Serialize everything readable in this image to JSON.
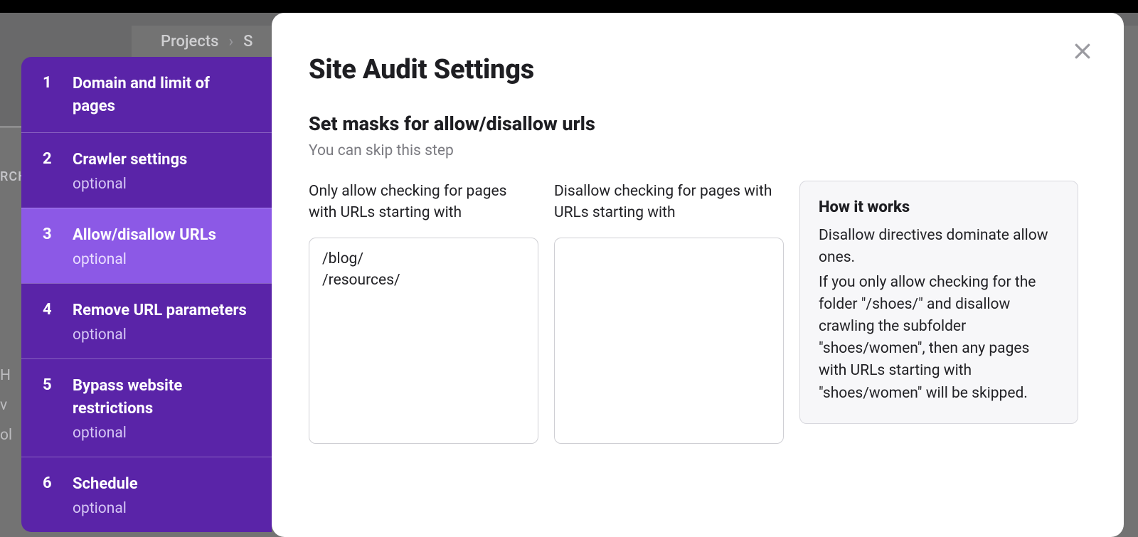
{
  "background": {
    "breadcrumb_root": "Projects",
    "breadcrumb_next_initial": "S",
    "left_label_fragment": "RCH",
    "left_item_1": "H",
    "left_item_2": "v",
    "left_item_3": "ol"
  },
  "wizard": {
    "steps": [
      {
        "num": "1",
        "title": "Domain and limit of pages",
        "optional": "",
        "active": false
      },
      {
        "num": "2",
        "title": "Crawler settings",
        "optional": "optional",
        "active": false
      },
      {
        "num": "3",
        "title": "Allow/disallow URLs",
        "optional": "optional",
        "active": true
      },
      {
        "num": "4",
        "title": "Remove URL parameters",
        "optional": "optional",
        "active": false
      },
      {
        "num": "5",
        "title": "Bypass website restrictions",
        "optional": "optional",
        "active": false
      },
      {
        "num": "6",
        "title": "Schedule",
        "optional": "optional",
        "active": false
      }
    ]
  },
  "panel": {
    "title": "Site Audit Settings",
    "subtitle": "Set masks for allow/disallow urls",
    "skip_hint": "You can skip this step",
    "allow_label": "Only allow checking for pages with URLs starting with",
    "disallow_label": "Disallow checking for pages with URLs starting with",
    "allow_value": "/blog/\n/resources/",
    "disallow_value": "",
    "info": {
      "title": "How it works",
      "p1": "Disallow directives dominate allow ones.",
      "p2": "If you only allow checking for the folder \"/shoes/\" and disallow crawling the subfolder \"shoes/women\", then any pages with URLs starting with \"shoes/women\" will be skipped."
    }
  }
}
